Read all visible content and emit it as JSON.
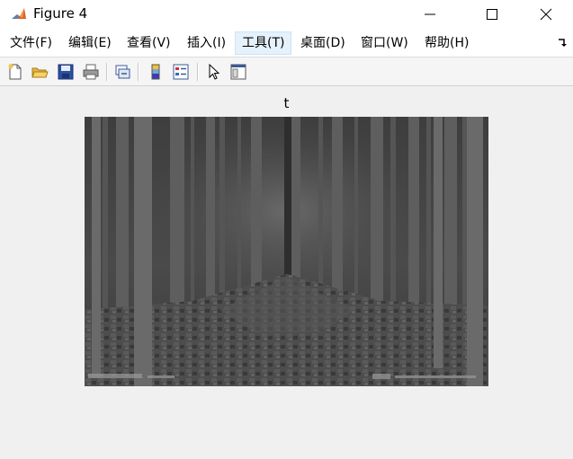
{
  "window": {
    "title": "Figure 4",
    "icon": "matlab-icon",
    "controls": [
      "minimize-icon",
      "maximize-icon",
      "close-icon"
    ]
  },
  "menubar": {
    "items": [
      {
        "label": "文件(F)"
      },
      {
        "label": "编辑(E)"
      },
      {
        "label": "查看(V)"
      },
      {
        "label": "插入(I)"
      },
      {
        "label": "工具(T)",
        "active": true
      },
      {
        "label": "桌面(D)"
      },
      {
        "label": "窗口(W)"
      },
      {
        "label": "帮助(H)"
      }
    ],
    "overflow_icon": "overflow-arrow-icon"
  },
  "toolbar": {
    "buttons": [
      "new-figure-icon",
      "open-file-icon",
      "save-icon",
      "print-icon",
      "link-axes-icon",
      "insert-colorbar-icon",
      "insert-legend-icon",
      "edit-plot-pointer-icon",
      "property-inspector-icon"
    ]
  },
  "axes": {
    "title": "t"
  },
  "colors": {
    "titlebar_bg": "#ffffff",
    "figure_bg": "#f0f0f0",
    "menu_active_bg": "#e5f1fb"
  }
}
